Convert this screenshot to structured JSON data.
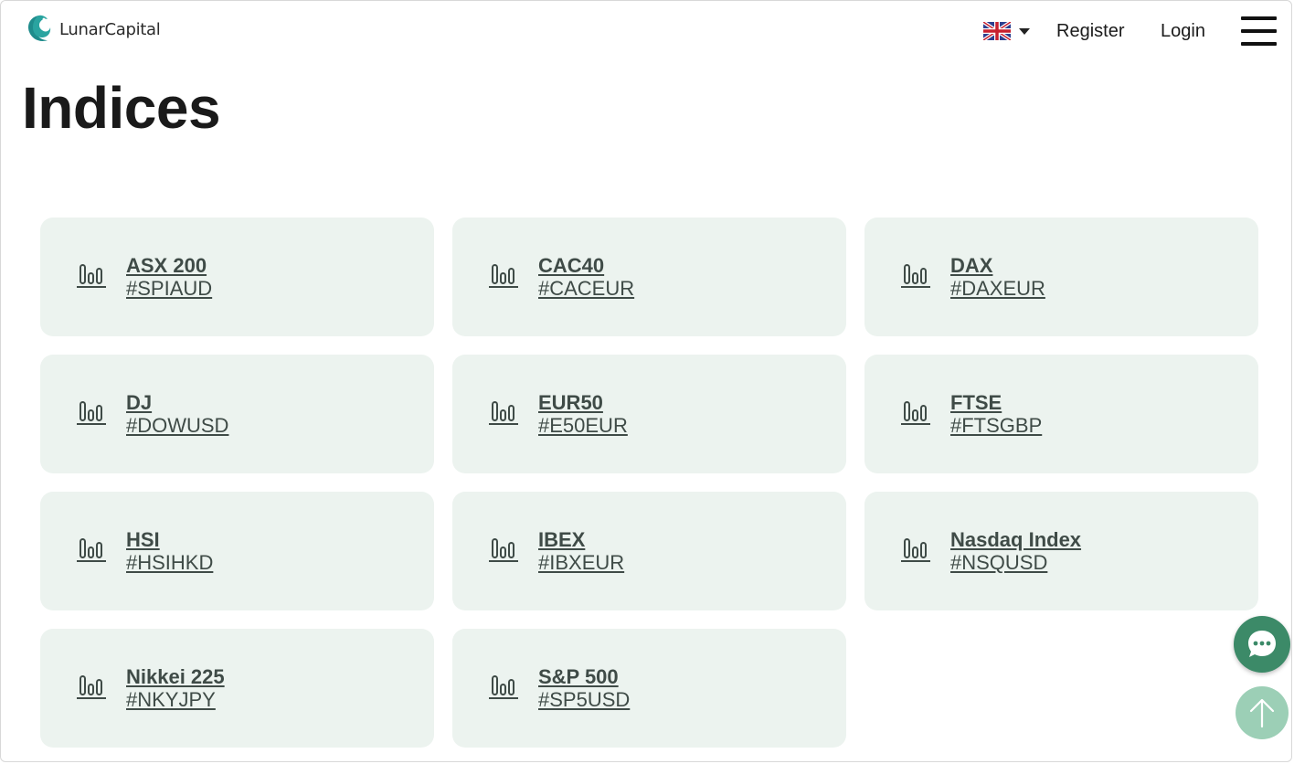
{
  "header": {
    "brand": "LunarCapital",
    "language_icon": "uk-flag-icon",
    "register_label": "Register",
    "login_label": "Login"
  },
  "page": {
    "title": "Indices"
  },
  "indices": [
    {
      "name": "ASX 200",
      "code": "#SPIAUD"
    },
    {
      "name": "CAC40",
      "code": "#CACEUR"
    },
    {
      "name": "DAX",
      "code": "#DAXEUR"
    },
    {
      "name": "DJ",
      "code": "#DOWUSD"
    },
    {
      "name": "EUR50",
      "code": "#E50EUR"
    },
    {
      "name": "FTSE",
      "code": "#FTSGBP"
    },
    {
      "name": "HSI",
      "code": "#HSIHKD"
    },
    {
      "name": "IBEX",
      "code": "#IBXEUR"
    },
    {
      "name": "Nasdaq Index",
      "code": "#NSQUSD"
    },
    {
      "name": "Nikkei 225",
      "code": "#NKYJPY"
    },
    {
      "name": "S&P 500",
      "code": "#SP5USD"
    }
  ],
  "colors": {
    "card_bg": "#ecf3ef",
    "text": "#3f4b47",
    "chat_button": "#3c8a68",
    "scroll_top_button": "#9ccfb6",
    "brand_teal": "#1f8c8c"
  },
  "icons": {
    "index_icon": "bar-chart-icon",
    "chat": "chat-bubble-icon",
    "scroll_top": "arrow-up-icon",
    "menu": "hamburger-menu-icon"
  }
}
